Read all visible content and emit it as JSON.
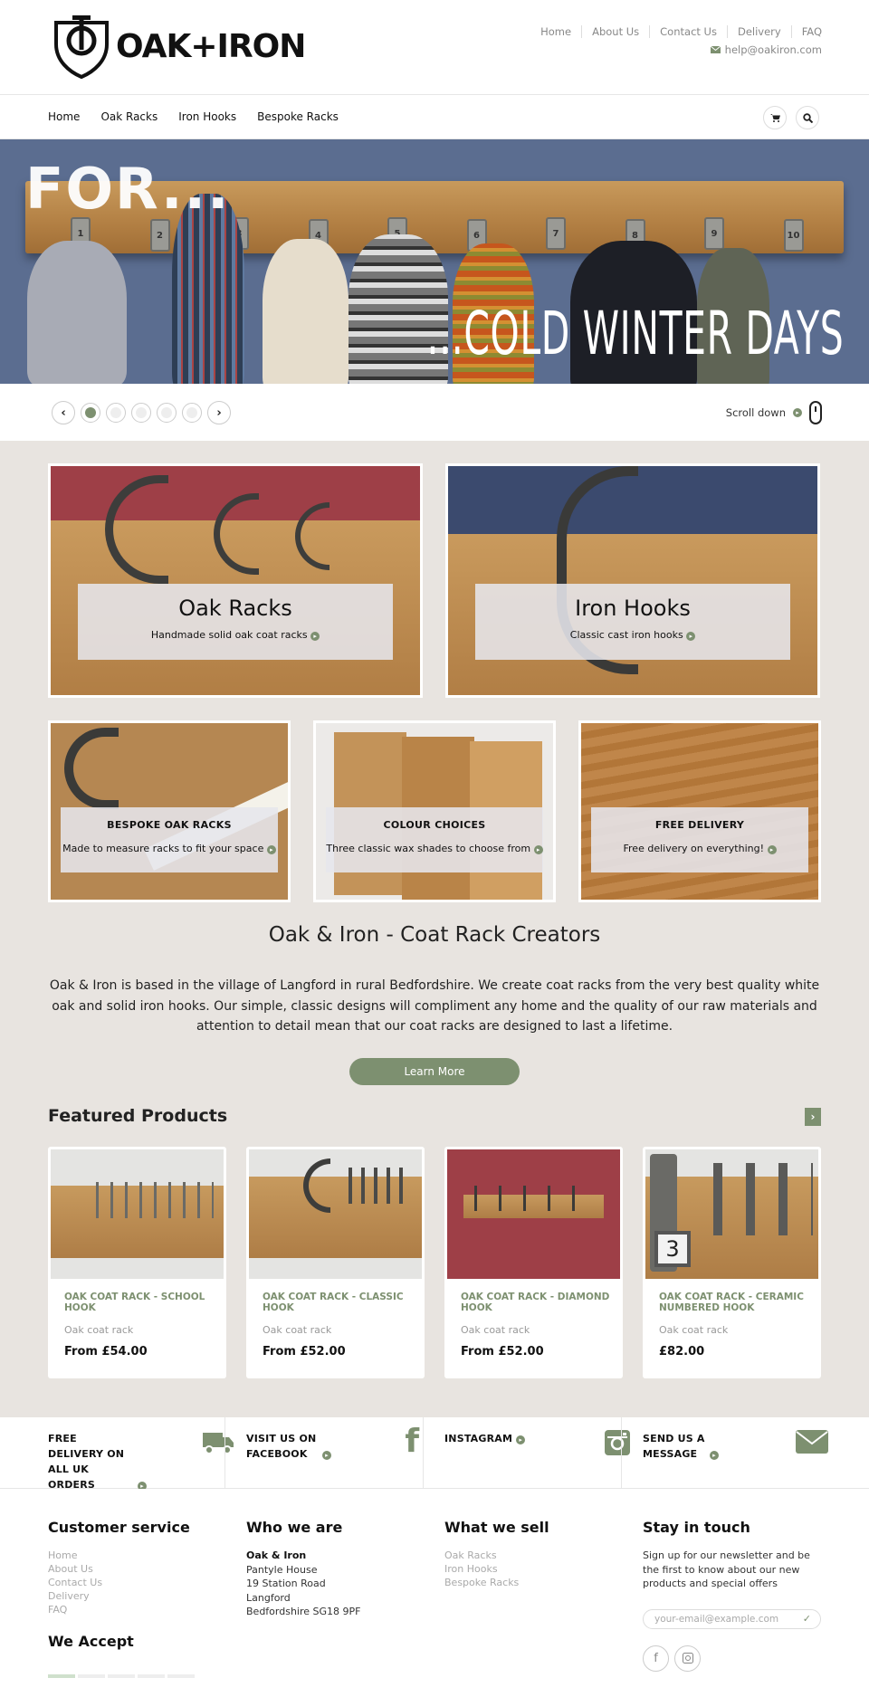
{
  "brand": {
    "name": "OAK+IRON"
  },
  "top_links": [
    "Home",
    "About Us",
    "Contact Us",
    "Delivery",
    "FAQ"
  ],
  "contact_email": "help@oakiron.com",
  "nav": [
    "Home",
    "Oak Racks",
    "Iron Hooks",
    "Bespoke Racks"
  ],
  "nav_icons": [
    "cart-icon",
    "search-icon"
  ],
  "hero": {
    "line1": "FOR...",
    "line2": "...COLD WINTER DAYS",
    "hook_numbers": [
      "1",
      "2",
      "3",
      "4",
      "5",
      "6",
      "7",
      "8",
      "9",
      "10"
    ]
  },
  "slider": {
    "slide_count": 5,
    "active_slide": 1,
    "scroll_label": "Scroll down"
  },
  "tiles_big": [
    {
      "title": "Oak Racks",
      "subtitle": "Handmade solid oak coat racks"
    },
    {
      "title": "Iron Hooks",
      "subtitle": "Classic cast iron hooks"
    }
  ],
  "tiles_small": [
    {
      "title": "BESPOKE OAK RACKS",
      "subtitle": "Made to measure racks to fit your space"
    },
    {
      "title": "COLOUR CHOICES",
      "subtitle": "Three classic wax shades to choose from"
    },
    {
      "title": "FREE DELIVERY",
      "subtitle": "Free delivery on everything!"
    }
  ],
  "about": {
    "title": "Oak & Iron - Coat Rack Creators",
    "body": "Oak & Iron is based in the village of Langford in rural Bedfordshire. We create coat racks from the very best quality white oak and solid iron hooks. Our simple, classic designs will compliment any home and the quality of our raw materials and attention to detail mean that our coat racks are designed to last a lifetime.",
    "button": "Learn More"
  },
  "featured": {
    "title": "Featured Products",
    "products": [
      {
        "name": "OAK COAT RACK - SCHOOL HOOK",
        "category": "Oak coat rack",
        "price": "From £54.00"
      },
      {
        "name": "OAK COAT RACK - CLASSIC HOOK",
        "category": "Oak coat rack",
        "price": "From £52.00"
      },
      {
        "name": "OAK COAT RACK - DIAMOND HOOK",
        "category": "Oak coat rack",
        "price": "From £52.00"
      },
      {
        "name": "OAK COAT RACK - CERAMIC NUMBERED HOOK",
        "category": "Oak coat rack",
        "price": "£82.00"
      }
    ]
  },
  "strip": [
    {
      "label": "FREE DELIVERY ON ALL UK ORDERS",
      "icon": "truck-icon"
    },
    {
      "label": "VISIT US ON FACEBOOK",
      "icon": "facebook-icon"
    },
    {
      "label": "INSTAGRAM",
      "icon": "instagram-icon"
    },
    {
      "label": "SEND US A MESSAGE",
      "icon": "envelope-icon"
    }
  ],
  "footer": {
    "customer_service": {
      "title": "Customer service",
      "links": [
        "Home",
        "About Us",
        "Contact Us",
        "Delivery",
        "FAQ"
      ]
    },
    "who_we_are": {
      "title": "Who we are",
      "company": "Oak & Iron",
      "address": [
        "Pantyle House",
        "19 Station Road",
        "Langford",
        "Bedfordshire SG18 9PF"
      ]
    },
    "what_we_sell": {
      "title": "What we sell",
      "links": [
        "Oak Racks",
        "Iron Hooks",
        "Bespoke Racks"
      ]
    },
    "stay_in_touch": {
      "title": "Stay in touch",
      "text": "Sign up for our newsletter and be the first to know about our new products and special offers",
      "placeholder": "your-email@example.com"
    },
    "we_accept": "We Accept"
  },
  "colors": {
    "accent": "#7d9070",
    "hero_bg": "#5b6d90",
    "main_bg": "#e8e4e0"
  }
}
